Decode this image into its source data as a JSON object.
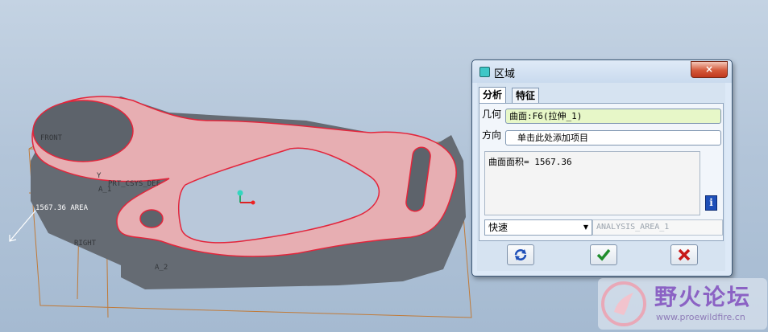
{
  "viewport": {
    "labels": {
      "front": "FRONT",
      "area": "1567.36 AREA",
      "right": "RIGHT",
      "csys": "PRT_CSYS_DEF",
      "axis1": "A_1",
      "axis2": "A_2",
      "y": "Y"
    },
    "colors": {
      "part_top": "#e7aeb2",
      "part_side": "#656b73",
      "edge": "#e3253b",
      "datum": "#c07a38"
    }
  },
  "dialog": {
    "title": "区域",
    "close_label": "×",
    "tabs": [
      "分析",
      "特征"
    ],
    "geometry_label": "几何",
    "geometry_value": "曲面:F6(拉伸_1)",
    "direction_label": "方向",
    "direction_value": "单击此处添加项目",
    "result_text": "曲面面积= 1567.36",
    "mode_value": "快速",
    "name_value": "ANALYSIS_AREA_1",
    "colors": {
      "geometry_field": "#e7f7c8",
      "accent": "#1e4fb8"
    }
  },
  "watermark": {
    "title": "野火论坛",
    "url": "www.proewildfire.cn"
  }
}
